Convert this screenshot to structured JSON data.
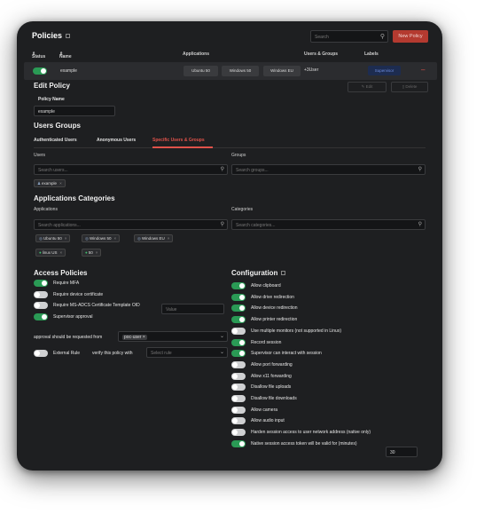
{
  "header": {
    "title": "Policies",
    "search_placeholder": "Search",
    "new_policy_label": "New Policy"
  },
  "table": {
    "columns": [
      "Status",
      "Name",
      "Applications",
      "Users & Groups",
      "Labels"
    ],
    "row": {
      "name": "example",
      "apps": [
        "Ubuntu 50",
        "Windows 50",
        "Windows EU"
      ],
      "users": "+3User",
      "label": "Supervisor",
      "status_on": true
    }
  },
  "edit": {
    "title": "Edit Policy",
    "edit_label": "Edit",
    "delete_label": "Delete",
    "policy_name_label": "Policy Name",
    "policy_name_value": "example"
  },
  "users_groups": {
    "title": "Users Groups",
    "tabs": [
      "Authenticated Users",
      "Anonymous Users",
      "Specific Users & Groups"
    ],
    "active_tab": 2,
    "users_label": "Users",
    "groups_label": "Groups",
    "users_placeholder": "Search users...",
    "groups_placeholder": "Search groups...",
    "user_chip": "example"
  },
  "apps_categories": {
    "title": "Applications Categories",
    "apps_label": "Applications",
    "cats_label": "Categories",
    "apps_placeholder": "Search applications...",
    "cats_placeholder": "Search categories...",
    "chips": [
      "Ubuntu 50",
      "Windows 50",
      "Windows EU",
      "linux US",
      "50"
    ]
  },
  "access": {
    "title": "Access Policies",
    "items": [
      {
        "label": "Require MFA",
        "on": true
      },
      {
        "label": "Require device certificate",
        "on": false
      },
      {
        "label": "Require MS-ADCS Certificate Template OID",
        "on": false
      },
      {
        "label": "Supervisor approval",
        "on": true
      }
    ],
    "oid_placeholder": "Value",
    "approval_label": "approval should be requested from",
    "approval_value": "poc-user",
    "external_rule_label": "External Rule",
    "verify_label": "verify this policy with",
    "select_placeholder": "Select rule"
  },
  "configuration": {
    "title": "Configuration",
    "items": [
      {
        "label": "Allow clipboard",
        "on": true
      },
      {
        "label": "Allow drive redirection",
        "on": true
      },
      {
        "label": "Allow device redirection",
        "on": true
      },
      {
        "label": "Allow printer redirection",
        "on": true
      },
      {
        "label": "Use multiple monitors (not supported in Linux)",
        "on": false
      },
      {
        "label": "Record session",
        "on": true
      },
      {
        "label": "Supervisor can interact with session",
        "on": true
      },
      {
        "label": "Allow port forwarding",
        "on": false
      },
      {
        "label": "Allow x11 forwarding",
        "on": false
      },
      {
        "label": "Disallow file uploads",
        "on": false
      },
      {
        "label": "Disallow file downloads",
        "on": false
      },
      {
        "label": "Allow camera",
        "on": false
      },
      {
        "label": "Allow audio input",
        "on": false
      },
      {
        "label": "Harden session access to user network address (native only)",
        "on": false
      },
      {
        "label": "Native session access token will be valid for (minutes)",
        "on": true
      }
    ],
    "token_minutes": "30"
  },
  "colors": {
    "accent": "#e0524a",
    "toggle_on": "#2a9a55",
    "primary_btn": "#b43a30",
    "label_badge": "#6d8de0"
  }
}
